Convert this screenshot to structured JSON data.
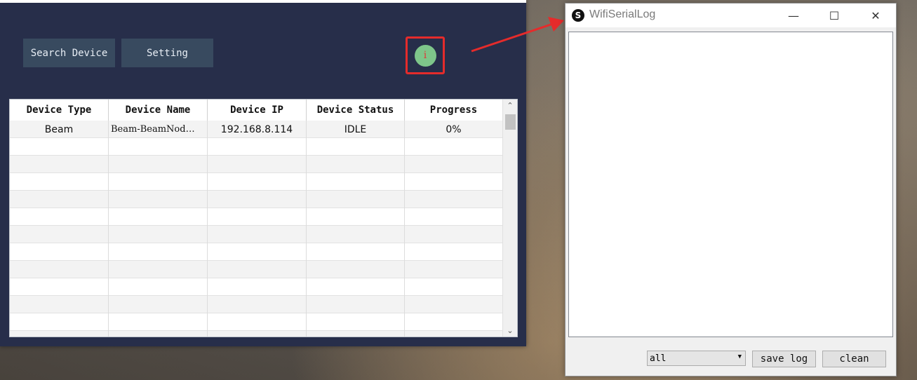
{
  "main_window": {
    "buttons": {
      "search_device": "Search Device",
      "setting": "Setting"
    },
    "info_icon_glyph": "i",
    "table": {
      "headers": [
        "Device Type",
        "Device Name",
        "Device IP",
        "Device Status",
        "Progress"
      ],
      "rows": [
        [
          "Beam",
          "Beam-BeamNod…",
          "192.168.8.114",
          "IDLE",
          "0%"
        ]
      ],
      "empty_rows": 12
    },
    "scroll_up_glyph": "⌃",
    "scroll_down_glyph": "⌄"
  },
  "log_window": {
    "title": "WifiSerialLog",
    "app_icon_glyph": "S",
    "controls": {
      "minimize": "—",
      "maximize": "☐",
      "close": "✕"
    },
    "log_content": "",
    "filter": {
      "selected": "all",
      "dropdown_glyph": "▼"
    },
    "buttons": {
      "save_log": "save log",
      "clean": "clean"
    }
  },
  "colors": {
    "app_background": "#272e4a",
    "button_background": "#384a5f",
    "info_icon": "#7ec58a",
    "highlight_red": "#e52b2b"
  }
}
